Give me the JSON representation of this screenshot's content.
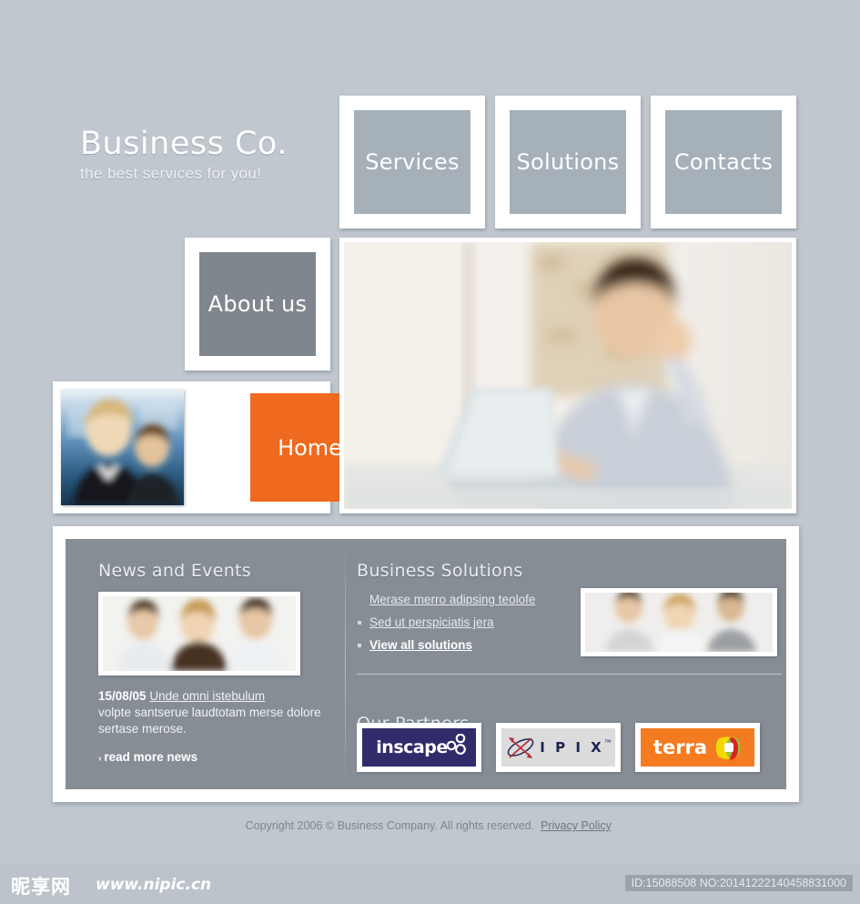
{
  "site": {
    "logo_title": "Business Co.",
    "logo_tagline": "the best services for you!"
  },
  "nav": {
    "items": [
      {
        "id": "services",
        "label": "Services"
      },
      {
        "id": "solutions",
        "label": "Solutions"
      },
      {
        "id": "contacts",
        "label": "Contacts"
      },
      {
        "id": "about",
        "label": "About us"
      },
      {
        "id": "home",
        "label": "Home"
      }
    ]
  },
  "hero": {
    "alt": "man working at laptop"
  },
  "news": {
    "heading": "News and Events",
    "thumb_alt": "three colleagues in meeting",
    "date": "15/08/05",
    "headline_link": "Unde omni istebulum",
    "body": "volpte santserue laudtotam merse dolore sertase merose.",
    "read_more": "read more news",
    "read_more_arrow": "›"
  },
  "solutions": {
    "heading": "Business Solutions",
    "links": [
      {
        "label": "Merase merro adipsing teolofe",
        "bullet": false,
        "bold": false
      },
      {
        "label": "Sed ut perspiciatis jera",
        "bullet": true,
        "bold": false
      },
      {
        "label": "View all solutions",
        "bullet": true,
        "bold": true
      }
    ],
    "thumb_alt": "three people standing"
  },
  "partners": {
    "heading": "Our Partners",
    "items": [
      {
        "id": "inscape",
        "label": "inscape",
        "bg": "#312a6b",
        "fg": "#ffffff"
      },
      {
        "id": "ipix",
        "label": "I P I X",
        "bg": "#dcdcdc",
        "fg": "#1a2250"
      },
      {
        "id": "terra",
        "label": "terra",
        "bg": "#f47b20",
        "fg": "#ffffff"
      }
    ]
  },
  "footer": {
    "copyright": "Copyright 2006 © Business Company. All rights reserved.",
    "privacy_link": "Privacy Policy"
  },
  "watermark": {
    "cn_text": "昵享网",
    "url": "www.nipic.cn",
    "id_text": "ID:15088508 NO:20141222140458831000"
  },
  "colors": {
    "page_bg": "#c0c7ce",
    "nav_light": "#a5b0b9",
    "nav_dark": "#7f868d",
    "accent_orange": "#ef6a1e",
    "panel_gray": "#868d95",
    "frame_white": "#ffffff"
  }
}
